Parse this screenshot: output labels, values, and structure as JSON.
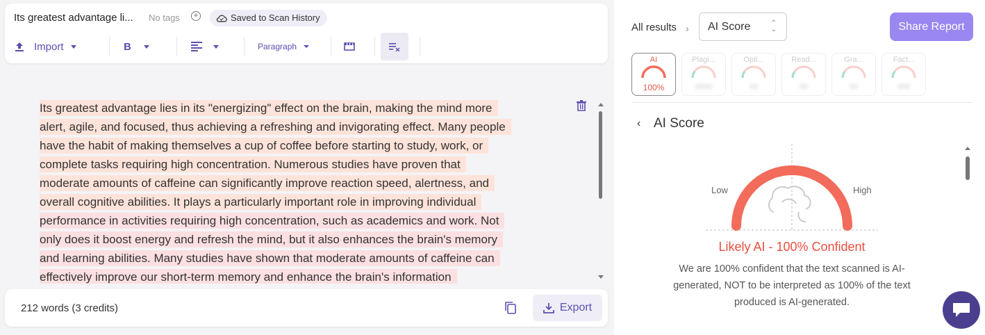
{
  "editor": {
    "doc_title": "Its greatest advantage li...",
    "no_tags": "No tags",
    "saved_label": "Saved to Scan History",
    "toolbar": {
      "import_label": "Import",
      "bold_label": "B",
      "paragraph_label": "Paragraph"
    },
    "lines": [
      "Its greatest advantage lies in its \"energizing\" effect on the brain, making the mind more",
      "alert, agile, and focused, thus achieving a refreshing and invigorating effect. Many people",
      "have the habit of making themselves a cup of coffee before starting to study, work, or",
      "complete tasks requiring high concentration. Numerous studies have proven that",
      "moderate amounts of caffeine can significantly improve reaction speed, alertness, and",
      "overall cognitive abilities. It plays a particularly important role in improving individual",
      "performance in activities requiring high concentration, such as academics and work. Not",
      "only does it boost energy and refresh the mind, but it also enhances the brain's memory",
      "and learning abilities. Many studies have shown that moderate amounts of caffeine can",
      "effectively improve our short-term memory and enhance the brain's information"
    ],
    "footer": {
      "word_count": "212 words (3 credits)",
      "export_label": "Export"
    }
  },
  "results": {
    "breadcrumb": "All results",
    "selected_score": "AI Score",
    "share_label": "Share Report",
    "tabs": [
      {
        "label": "AI",
        "value": "100%"
      },
      {
        "label": "Plagi...",
        "value": "0000"
      },
      {
        "label": "Opti...",
        "value": "00"
      },
      {
        "label": "Read...",
        "value": "00"
      },
      {
        "label": "Gra...",
        "value": "00"
      },
      {
        "label": "Fact...",
        "value": "000"
      }
    ],
    "section_title": "AI Score",
    "gauge": {
      "low_label": "Low",
      "high_label": "High",
      "level": 1.0,
      "color": "#f26b5b"
    },
    "verdict": "Likely AI - 100% Confident",
    "description": "We are 100% confident that the text scanned is AI-generated, NOT to be interpreted as 100% of the text produced is AI-generated."
  },
  "colors": {
    "accent": "#5a4fb0",
    "share_button": "#9b87f0",
    "highlight": "#fde3d9",
    "verdict": "#e94f3f"
  }
}
